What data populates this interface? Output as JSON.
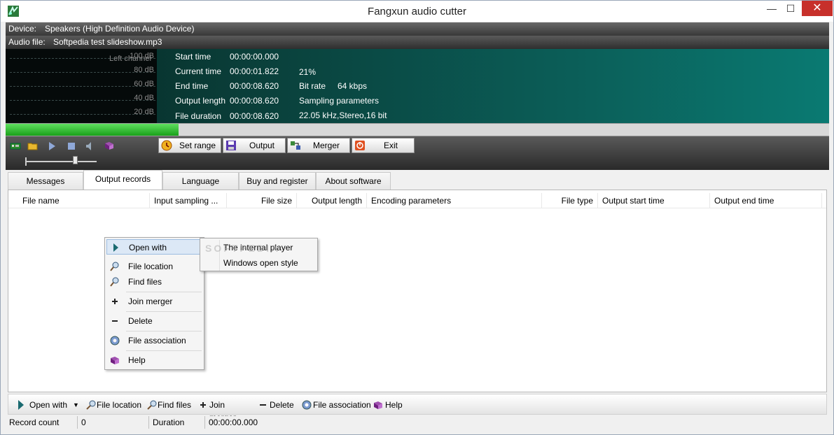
{
  "window": {
    "title": "Fangxun audio cutter",
    "minimize": "—",
    "maximize": "☐",
    "close": "✕"
  },
  "device": {
    "label": "Device:",
    "value": "Speakers (High Definition Audio Device)"
  },
  "audio_file": {
    "label": "Audio file:",
    "value": "Softpedia test slideshow.mp3"
  },
  "meter": {
    "channel": "Left channel",
    "levels": [
      "100 dB",
      "80 dB",
      "60 dB",
      "40 dB",
      "20 dB"
    ]
  },
  "info": {
    "start_time_label": "Start time",
    "start_time": "00:00:00.000",
    "current_time_label": "Current time",
    "current_time": "00:00:01.822",
    "end_time_label": "End time",
    "end_time": "00:00:08.620",
    "output_length_label": "Output length",
    "output_length": "00:00:08.620",
    "file_duration_label": "File duration",
    "file_duration": "00:00:08.620",
    "percent": "21%",
    "bit_rate_label": "Bit rate",
    "bit_rate": "64 kbps",
    "sampling_label": "Sampling parameters",
    "sampling": "22.05  kHz,Stereo,16 bit"
  },
  "progress": 0.21,
  "toolbar": {
    "set_range": "Set range",
    "output": "Output",
    "merger": "Merger",
    "exit": "Exit"
  },
  "tabs": [
    "Messages",
    "Output records",
    "Language",
    "Buy and register",
    "About software"
  ],
  "columns": [
    "File name",
    "Input sampling ...",
    "File size",
    "Output length",
    "Encoding parameters",
    "File type",
    "Output start time",
    "Output end time"
  ],
  "context_menu": {
    "open_with": "Open with",
    "file_location": "File location",
    "find_files": "Find files",
    "join_merger": "Join merger",
    "delete": "Delete",
    "file_association": "File association",
    "help": "Help"
  },
  "submenu": {
    "internal_player": "The internal player",
    "windows_open_style": "Windows open style"
  },
  "watermark": "SOFTPEDIA",
  "bottom_toolbar": {
    "open_with": "Open with",
    "file_location": "File location",
    "find_files": "Find files",
    "join_merger": "Join merger",
    "delete": "Delete",
    "file_association": "File association",
    "help": "Help"
  },
  "status": {
    "record_count_label": "Record count",
    "record_count": "0",
    "duration_label": "Duration",
    "duration": "00:00:00.000"
  }
}
